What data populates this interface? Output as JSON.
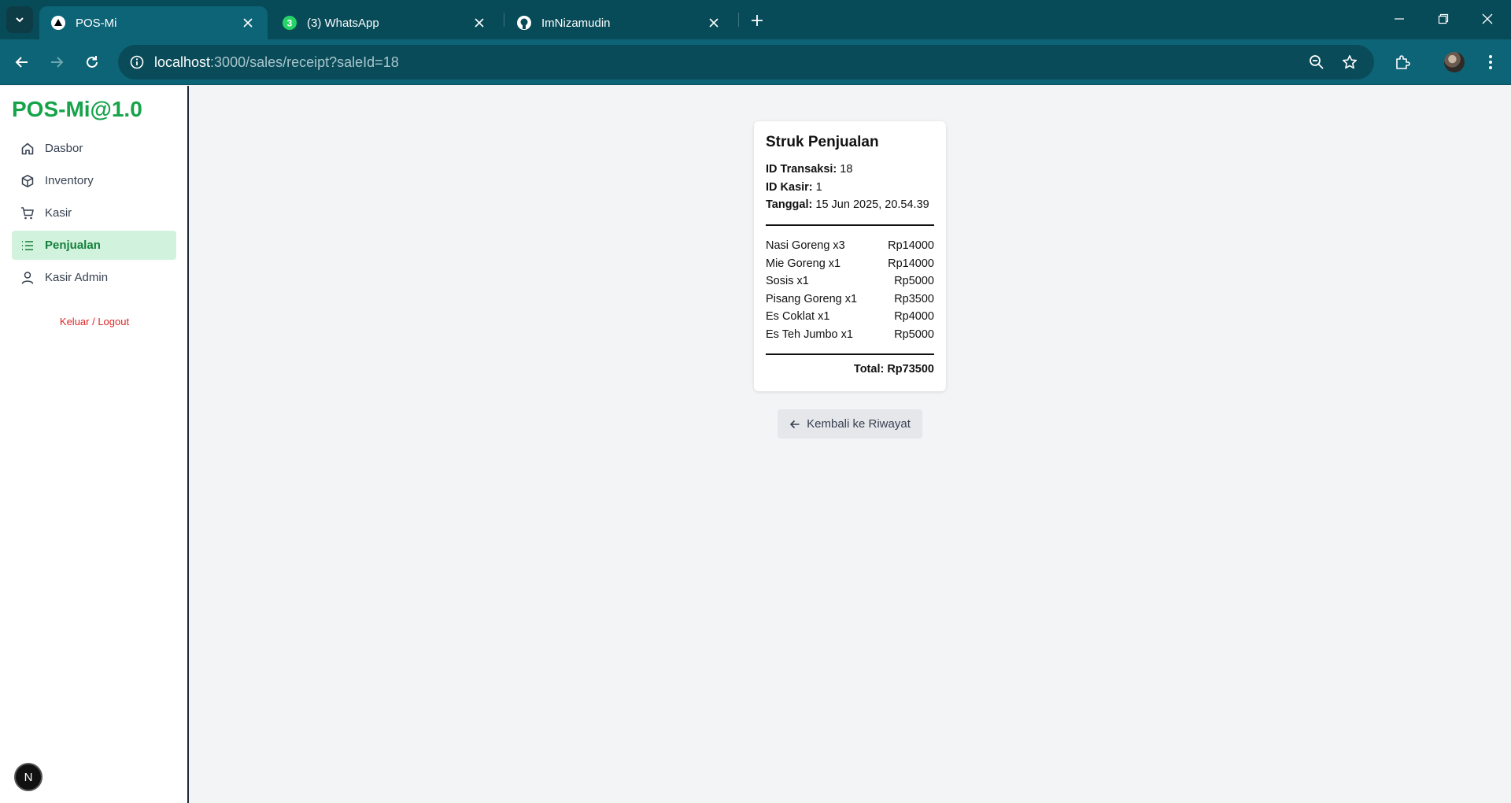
{
  "browser": {
    "tabs": [
      {
        "title": "POS-Mi",
        "icon": "triangle-icon",
        "active": true
      },
      {
        "title": "(3) WhatsApp",
        "icon": "whatsapp-icon",
        "badge": "3",
        "active": false
      },
      {
        "title": "ImNizamudin",
        "icon": "github-icon",
        "active": false
      }
    ],
    "url_host": "localhost",
    "url_rest": ":3000/sales/receipt?saleId=18"
  },
  "sidebar": {
    "brand": "POS-Mi@1.0",
    "items": [
      {
        "label": "Dasbor",
        "icon": "home-icon",
        "active": false
      },
      {
        "label": "Inventory",
        "icon": "box-icon",
        "active": false
      },
      {
        "label": "Kasir",
        "icon": "cart-icon",
        "active": false
      },
      {
        "label": "Penjualan",
        "icon": "list-icon",
        "active": true
      },
      {
        "label": "Kasir Admin",
        "icon": "user-icon",
        "active": false
      }
    ],
    "logout": "Keluar / Logout"
  },
  "receipt": {
    "title": "Struk Penjualan",
    "transaction_label": "ID Transaksi:",
    "transaction_id": "18",
    "cashier_label": "ID Kasir:",
    "cashier_id": "1",
    "date_label": "Tanggal:",
    "date": "15 Jun 2025, 20.54.39",
    "items": [
      {
        "name": "Nasi Goreng x3",
        "price": "Rp14000"
      },
      {
        "name": "Mie Goreng x1",
        "price": "Rp14000"
      },
      {
        "name": "Sosis x1",
        "price": "Rp5000"
      },
      {
        "name": "Pisang Goreng x1",
        "price": "Rp3500"
      },
      {
        "name": "Es Coklat x1",
        "price": "Rp4000"
      },
      {
        "name": "Es Teh Jumbo x1",
        "price": "Rp5000"
      }
    ],
    "total": "Total: Rp73500"
  },
  "back_button": "Kembali ke Riwayat",
  "dev_badge": "N",
  "colors": {
    "brand": "#16a34a",
    "active_bg": "#d1f2dc",
    "logout": "#dc2626"
  }
}
